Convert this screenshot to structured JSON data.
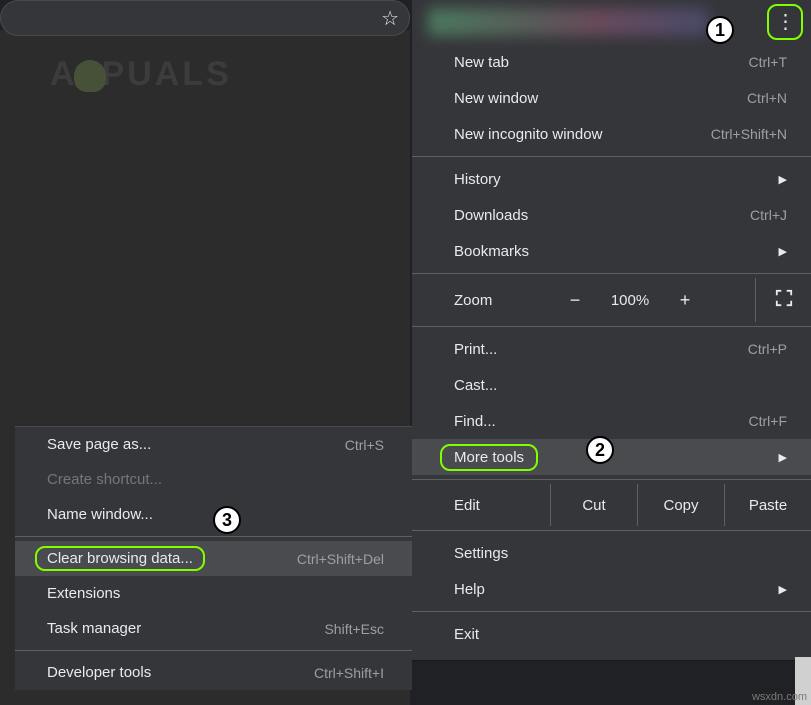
{
  "logo_text_left": "A",
  "logo_text_right": "PUALS",
  "main_menu": {
    "new_tab": {
      "label": "New tab",
      "shortcut": "Ctrl+T"
    },
    "new_window": {
      "label": "New window",
      "shortcut": "Ctrl+N"
    },
    "new_incognito": {
      "label": "New incognito window",
      "shortcut": "Ctrl+Shift+N"
    },
    "history": {
      "label": "History"
    },
    "downloads": {
      "label": "Downloads",
      "shortcut": "Ctrl+J"
    },
    "bookmarks": {
      "label": "Bookmarks"
    },
    "zoom": {
      "label": "Zoom",
      "value": "100%",
      "minus": "−",
      "plus": "+"
    },
    "print": {
      "label": "Print...",
      "shortcut": "Ctrl+P"
    },
    "cast": {
      "label": "Cast..."
    },
    "find": {
      "label": "Find...",
      "shortcut": "Ctrl+F"
    },
    "more_tools": {
      "label": "More tools"
    },
    "edit": {
      "label": "Edit",
      "cut": "Cut",
      "copy": "Copy",
      "paste": "Paste"
    },
    "settings": {
      "label": "Settings"
    },
    "help": {
      "label": "Help"
    },
    "exit": {
      "label": "Exit"
    }
  },
  "sub_menu": {
    "save_page": {
      "label": "Save page as...",
      "shortcut": "Ctrl+S"
    },
    "create_shortcut": {
      "label": "Create shortcut..."
    },
    "name_window": {
      "label": "Name window..."
    },
    "clear_browsing": {
      "label": "Clear browsing data...",
      "shortcut": "Ctrl+Shift+Del"
    },
    "extensions": {
      "label": "Extensions"
    },
    "task_manager": {
      "label": "Task manager",
      "shortcut": "Shift+Esc"
    },
    "developer_tools": {
      "label": "Developer tools",
      "shortcut": "Ctrl+Shift+I"
    }
  },
  "callouts": {
    "one": "1",
    "two": "2",
    "three": "3"
  },
  "watermark": "wsxdn.com"
}
